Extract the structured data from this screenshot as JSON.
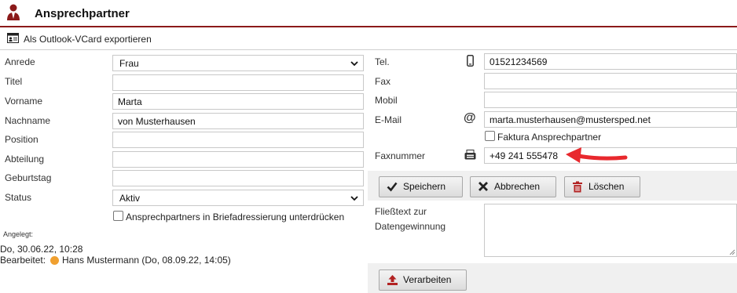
{
  "header": {
    "title": "Ansprechpartner",
    "icon": "person-icon"
  },
  "toolbar": {
    "vcard_label": "Als Outlook-VCard exportieren",
    "icon": "vcard-icon"
  },
  "left": {
    "anrede": {
      "label": "Anrede",
      "value": "Frau"
    },
    "titel": {
      "label": "Titel",
      "value": ""
    },
    "vorname": {
      "label": "Vorname",
      "value": "Marta"
    },
    "nachname": {
      "label": "Nachname",
      "value": "von Musterhausen"
    },
    "position": {
      "label": "Position",
      "value": ""
    },
    "abteilung": {
      "label": "Abteilung",
      "value": ""
    },
    "geburtstag": {
      "label": "Geburtstag",
      "value": ""
    },
    "status": {
      "label": "Status",
      "value": "Aktiv"
    },
    "brief_checkbox_label": "Ansprechpartners in Briefadressierung unterdrücken"
  },
  "meta": {
    "angelegt_label": "Angelegt:",
    "angelegt_value": "Do, 30.06.22, 10:28",
    "bearbeitet_label": "Bearbeitet:",
    "bearbeitet_value": "Hans Mustermann (Do, 08.09.22, 14:05)"
  },
  "right": {
    "tel": {
      "label": "Tel.",
      "value": "01521234569",
      "icon": "mobile-phone-icon"
    },
    "fax": {
      "label": "Fax",
      "value": ""
    },
    "mobil": {
      "label": "Mobil",
      "value": ""
    },
    "email": {
      "label": "E-Mail",
      "value": "marta.musterhausen@mustersped.net",
      "icon": "at-sign-icon"
    },
    "faktura_label": "Faktura Ansprechpartner",
    "faxnummer": {
      "label": "Faxnummer",
      "value": "+49 241 555478",
      "icon": "fax-machine-icon"
    },
    "fliesstext_label_1": "Fließtext zur",
    "fliesstext_label_2": "Datengewinnung"
  },
  "buttons": {
    "save": "Speichern",
    "cancel": "Abbrechen",
    "delete": "Löschen",
    "process": "Verarbeiten"
  },
  "colors": {
    "accent": "#8b1a1a",
    "arrow": "#e8282d",
    "button_icon": "#b22222"
  }
}
